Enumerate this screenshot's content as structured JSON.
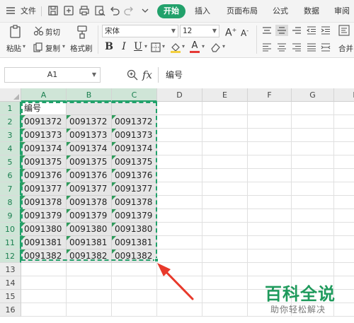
{
  "menubar": {
    "file_label": "文件",
    "tabs": [
      "开始",
      "插入",
      "页面布局",
      "公式",
      "数据",
      "审阅"
    ]
  },
  "ribbon": {
    "paste_label": "粘贴",
    "cut_label": "剪切",
    "copy_label": "复制",
    "format_painter_label": "格式刷",
    "font_name": "宋体",
    "font_size": "12",
    "merge_label": "合并"
  },
  "formula_bar": {
    "name_box": "A1",
    "fx_label": "fx",
    "content": "编号"
  },
  "sheet": {
    "columns": [
      "A",
      "B",
      "C",
      "D",
      "E",
      "F",
      "G",
      "H"
    ],
    "rows": [
      "1",
      "2",
      "3",
      "4",
      "5",
      "6",
      "7",
      "8",
      "9",
      "10",
      "11",
      "12",
      "13",
      "14",
      "15",
      "16"
    ],
    "header_cell": "编号",
    "values": [
      "0091372",
      "0091373",
      "0091374",
      "0091375",
      "0091376",
      "0091377",
      "0091378",
      "0091379",
      "0091380",
      "0091381",
      "0091382"
    ]
  },
  "colors": {
    "accent": "#22a16b",
    "arrow": "#e8392b",
    "watermark": "#1f9a5c"
  },
  "watermark": {
    "title": "百科全说",
    "subtitle": "助你轻松解决"
  }
}
